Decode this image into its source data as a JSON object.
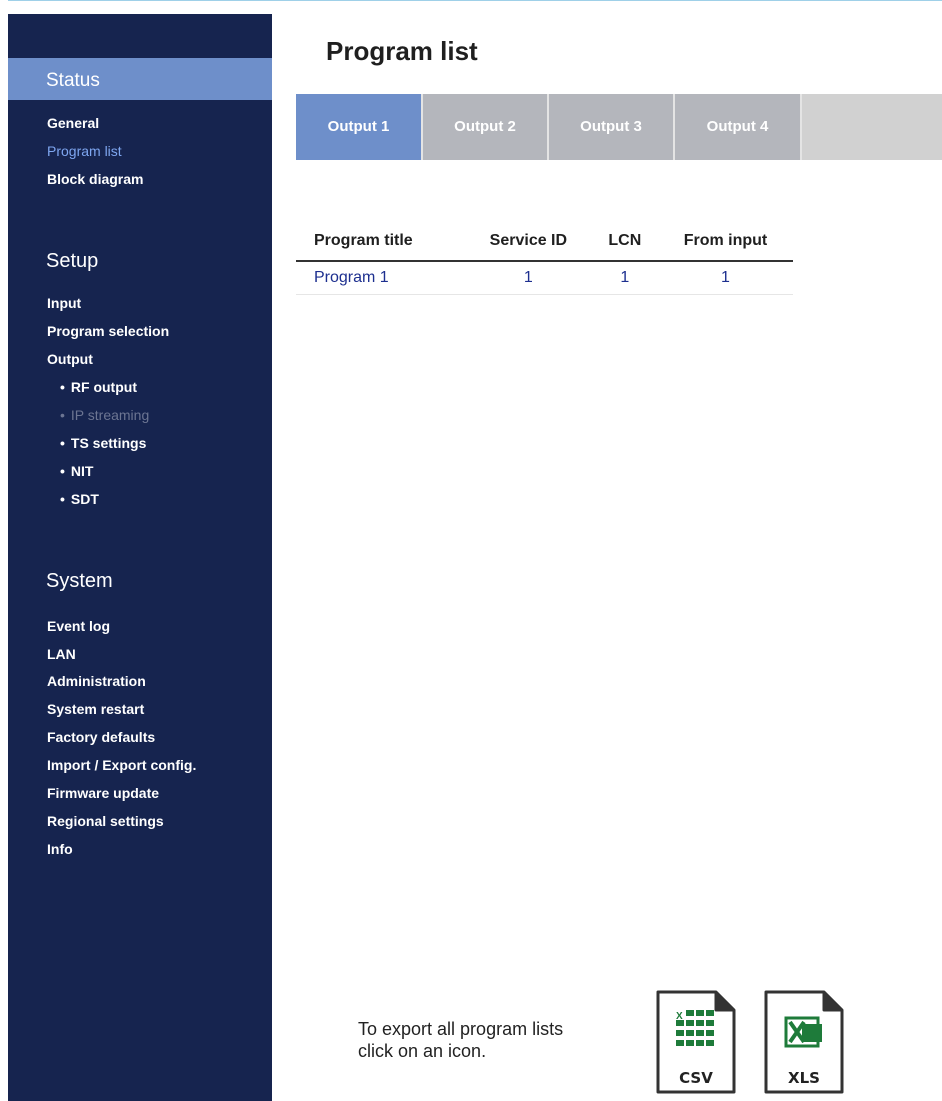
{
  "sidebar": {
    "status": {
      "heading": "Status",
      "items": [
        {
          "label": "General"
        },
        {
          "label": "Program list"
        },
        {
          "label": "Block diagram"
        }
      ]
    },
    "setup": {
      "heading": "Setup",
      "items": [
        {
          "label": "Input"
        },
        {
          "label": "Program selection"
        },
        {
          "label": "Output"
        }
      ],
      "subitems": [
        {
          "label": "RF output"
        },
        {
          "label": "IP streaming"
        },
        {
          "label": "TS settings"
        },
        {
          "label": "NIT"
        },
        {
          "label": "SDT"
        }
      ]
    },
    "system": {
      "heading": "System",
      "items": [
        {
          "label": "Event log"
        },
        {
          "label": "LAN"
        },
        {
          "label": "Administration"
        },
        {
          "label": "System restart"
        },
        {
          "label": "Factory defaults"
        },
        {
          "label": "Import / Export config."
        },
        {
          "label": "Firmware update"
        },
        {
          "label": "Regional settings"
        },
        {
          "label": "Info"
        }
      ]
    }
  },
  "main": {
    "title": "Program list",
    "tabs": [
      {
        "label": "Output 1"
      },
      {
        "label": "Output 2"
      },
      {
        "label": "Output 3"
      },
      {
        "label": "Output 4"
      }
    ],
    "table": {
      "headers": [
        "Program title",
        "Service ID",
        "LCN",
        "From input"
      ],
      "rows": [
        [
          "Program 1",
          "1",
          "1",
          "1"
        ]
      ]
    },
    "export": {
      "line1": "To export all program lists",
      "line2": "click on an icon.",
      "csv_label": "CSV",
      "xls_label": "XLS"
    }
  },
  "colors": {
    "sidebar_bg": "#16244f",
    "accent": "#6e8fca",
    "active_link": "#7ea6f0",
    "link": "#1d2f8f",
    "excel_green": "#1e7b3a"
  },
  "icons": {
    "bullet": "bullet-icon",
    "csv": "csv-file-icon",
    "xls": "xls-file-icon"
  }
}
